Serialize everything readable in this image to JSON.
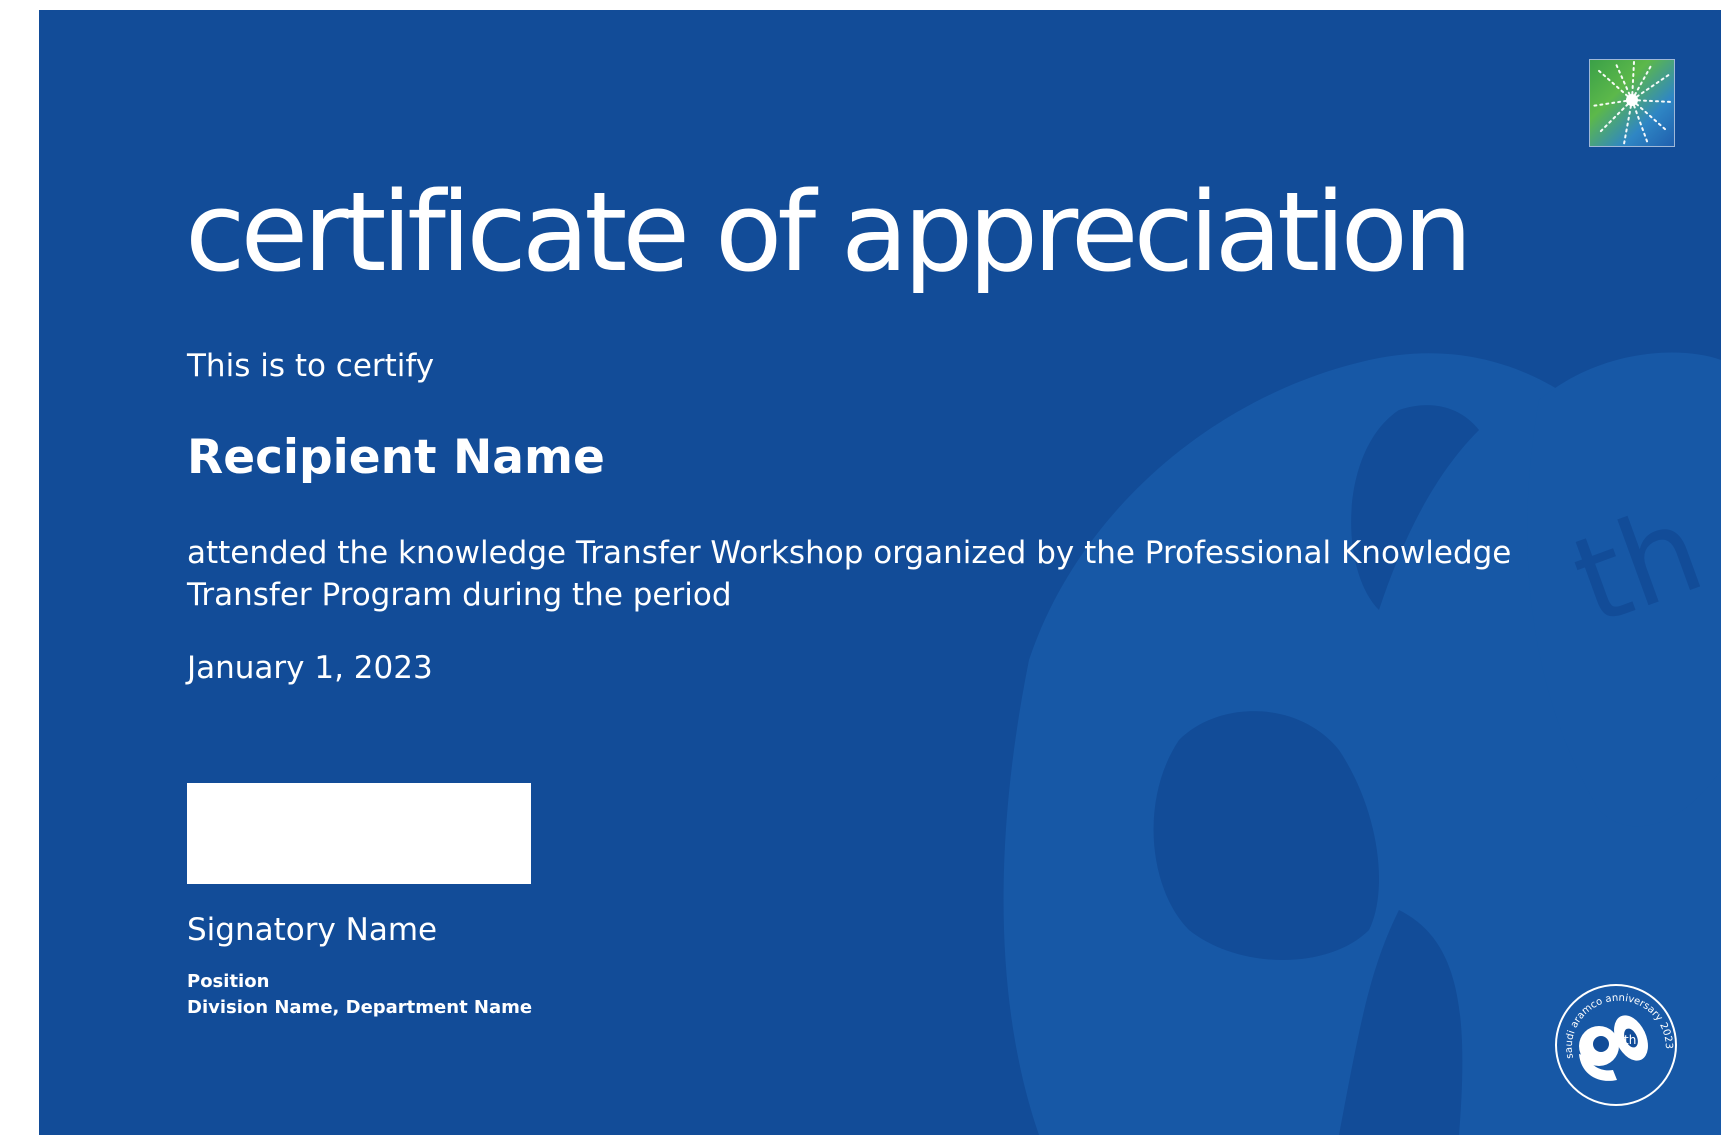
{
  "certificate": {
    "title": "certificate of appreciation",
    "intro": "This is to certify",
    "recipient": "Recipient Name",
    "body": "attended the knowledge Transfer Workshop organized by the Professional Knowledge Transfer Program during the period",
    "date": "January 1, 2023"
  },
  "signatory": {
    "name": "Signatory Name",
    "position": "Position",
    "department": "Division Name, Department Name"
  },
  "badge": {
    "arc_text": "saudi aramco anniversary 2023",
    "superscript": "th",
    "icon": "anniversary-90th-emblem"
  },
  "logo": {
    "icon": "aramco-star-logo"
  },
  "watermark": {
    "superscript": "th"
  },
  "colors": {
    "background": "#124c98",
    "watermark": "#1758a6",
    "text": "#ffffff"
  }
}
